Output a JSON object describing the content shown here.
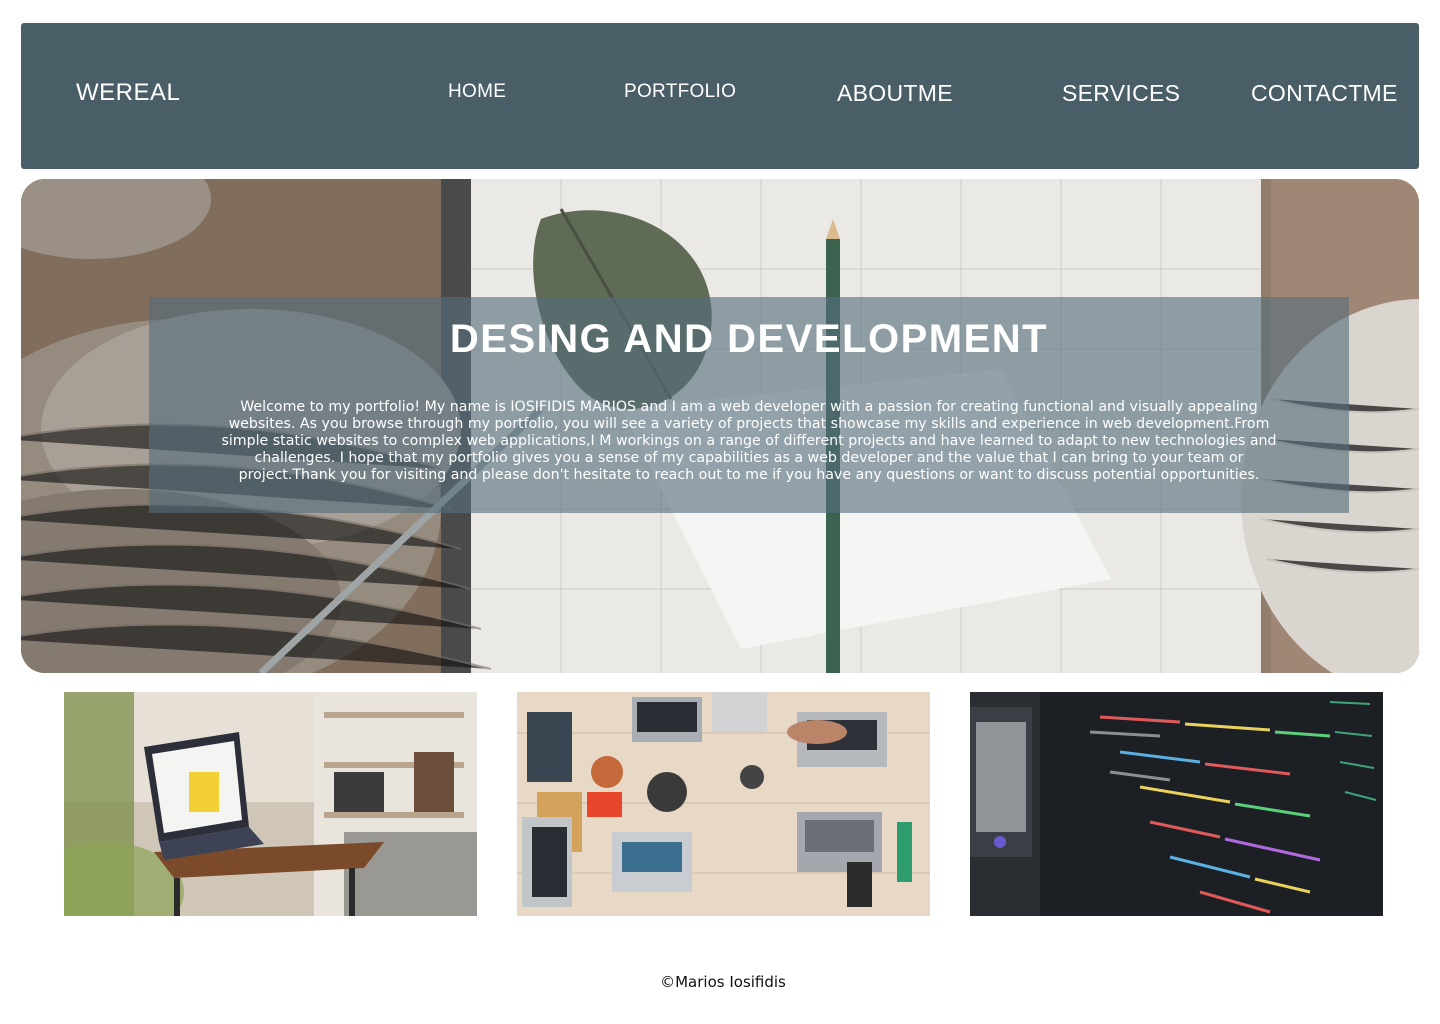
{
  "header": {
    "logo": "WEREAL",
    "nav": [
      {
        "label": "HOME"
      },
      {
        "label": "PORTFOLIO"
      },
      {
        "label": "ABOUTME"
      },
      {
        "label": "SERVICES"
      },
      {
        "label": "CONTACTME"
      }
    ],
    "background_color": "#4a5e68"
  },
  "hero": {
    "title": "DESING AND DEVELOPMENT",
    "paragraph": "Welcome to my portfolio! My name is IOSIFIDIS MARIOS and I am a web developer with a passion for creating functional and visually appealing websites. As you browse through my portfolio, you will see a variety of projects that showcase my skills and experience in web development.From simple static websites to complex web applications,I M workings on a range of different projects and have learned to adapt to new technologies and challenges. I hope that my portfolio gives you a sense of my capabilities as a web developer and the value that I can bring to your team or project.Thank you for visiting and please don't hesitate to reach out to me if you have any questions or want to discuss potential opportunities.",
    "background_image": "planner-calendar-knit-leaf-pencil-photo"
  },
  "gallery": [
    {
      "image": "tablet-on-side-table-photo"
    },
    {
      "image": "team-desk-laptops-overhead-photo"
    },
    {
      "image": "code-on-dark-screen-photo"
    }
  ],
  "footer": {
    "copyright": "©Marios Iosifidis"
  }
}
